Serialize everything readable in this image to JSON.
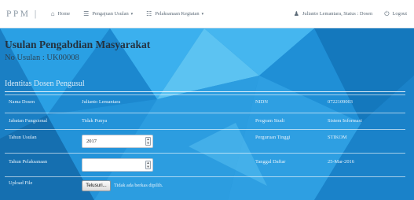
{
  "navbar": {
    "brand": "PPM |",
    "home_label": "Home",
    "pengajuan_label": "Pengajuan Usulan",
    "pelaksanaan_label": "Pelaksanaan Kegiatan",
    "user_label": "Julianto Lemantara, Status : Dosen",
    "logout_label": "Logout"
  },
  "page": {
    "title": "Usulan Pengabdian Masyarakat",
    "subtitle": "No Usulan : UK00008",
    "section_title": "Identitas Dosen Pengusul"
  },
  "rows": [
    {
      "label": "Nama Dosen",
      "value": "Julianto Lemantara",
      "label2": "NIDN",
      "value2": "0722109003"
    },
    {
      "label": "Jabatan Fungsional",
      "value": "Tidak Punya",
      "label2": "Program Studi",
      "value2": "Sistem Informasi"
    },
    {
      "label": "Tahun Usulan",
      "value": "2017",
      "label2": "Perguruan Tinggi",
      "value2": "STIKOM"
    },
    {
      "label": "Tahun Pelaksanaan",
      "value": "",
      "label2": "Tanggal Daftar",
      "value2": "25-Mar-2016"
    },
    {
      "label": "Upload File",
      "button": "Telusuri...",
      "file_status": "Tidak ada berkas dipilih."
    }
  ],
  "colors": {
    "background": "#1f8fd6",
    "navbar": "#ffffff",
    "title_text": "#24323f"
  }
}
